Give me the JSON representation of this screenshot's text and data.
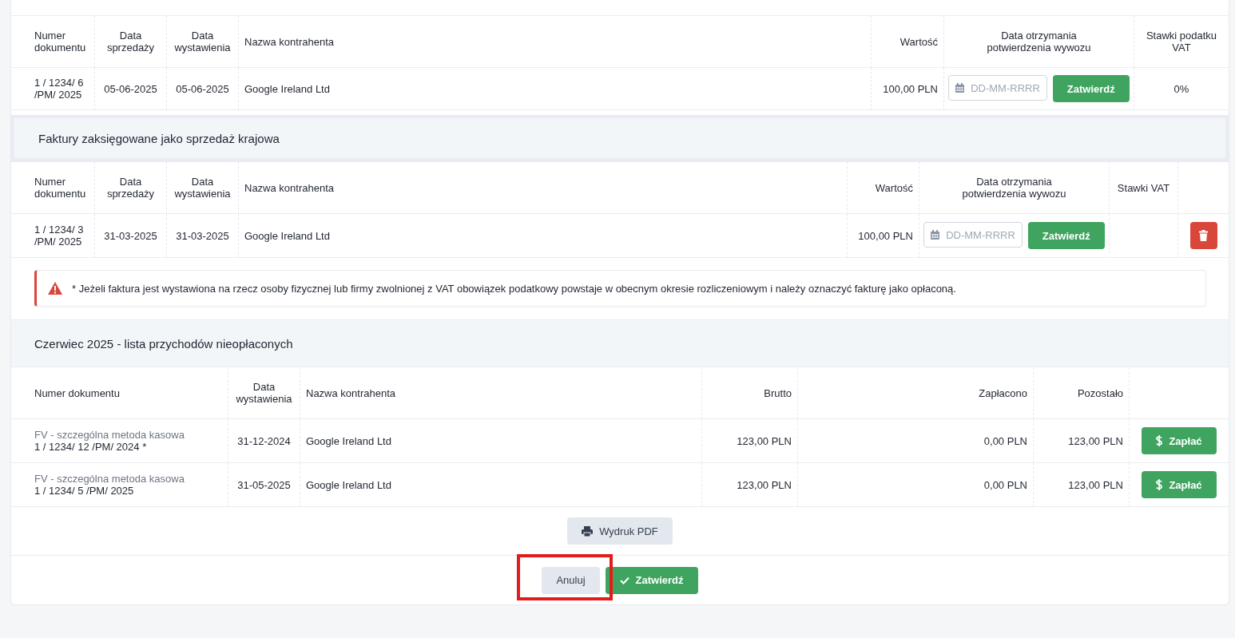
{
  "export_table": {
    "columns": [
      "Numer dokumentu",
      "Data sprzedaży",
      "Data wystawienia",
      "Nazwa kontrahenta",
      "Wartość",
      "Data otrzymania potwierdzenia wywozu",
      "Stawki podatku VAT"
    ],
    "rows": [
      {
        "document_number": "1 / 1234/ 6 /PM/ 2025",
        "sale_date": "05-06-2025",
        "issue_date": "05-06-2025",
        "contractor": "Google Ireland Ltd",
        "value": "100,00 PLN",
        "date_placeholder": "DD-MM-RRRR",
        "confirm_button": "Zatwierdź",
        "vat_rate": "0%"
      }
    ]
  },
  "domestic_section": {
    "title": "Faktury zaksięgowane jako sprzedaż krajowa",
    "columns": [
      "Numer dokumentu",
      "Data sprzedaży",
      "Data wystawienia",
      "Nazwa kontrahenta",
      "Wartość",
      "Data otrzymania potwierdzenia wywozu",
      "Stawki VAT"
    ],
    "rows": [
      {
        "document_number": "1 / 1234/ 3 /PM/ 2025",
        "sale_date": "31-03-2025",
        "issue_date": "31-03-2025",
        "contractor": "Google Ireland Ltd",
        "value": "100,00 PLN",
        "date_placeholder": "DD-MM-RRRR",
        "confirm_button": "Zatwierdź"
      }
    ]
  },
  "alert": {
    "text": "* Jeżeli faktura jest wystawiona na rzecz osoby fizycznej lub firmy zwolnionej z VAT obowiązek podatkowy powstaje w obecnym okresie rozliczeniowym i należy oznaczyć fakturę jako opłaconą."
  },
  "unpaid_section": {
    "title": "Czerwiec 2025 - lista przychodów nieopłaconych",
    "columns": [
      "Numer dokumentu",
      "Data wystawienia",
      "Nazwa kontrahenta",
      "Brutto",
      "Zapłacono",
      "Pozostało"
    ],
    "rows": [
      {
        "document_type": "FV - szczególna metoda kasowa",
        "document_number": "1 / 1234/ 12 /PM/ 2024 *",
        "issue_date": "31-12-2024",
        "contractor": "Google Ireland Ltd",
        "gross": "123,00 PLN",
        "paid": "0,00 PLN",
        "remaining": "123,00 PLN",
        "pay_button": "Zapłać"
      },
      {
        "document_type": "FV - szczególna metoda kasowa",
        "document_number": "1 / 1234/ 5 /PM/ 2025",
        "issue_date": "31-05-2025",
        "contractor": "Google Ireland Ltd",
        "gross": "123,00 PLN",
        "paid": "0,00 PLN",
        "remaining": "123,00 PLN",
        "pay_button": "Zapłać"
      }
    ]
  },
  "print_button": "Wydruk PDF",
  "footer_buttons": [
    {
      "kind": "cancel",
      "label": "Anuluj",
      "highlighted": true
    },
    {
      "kind": "confirm",
      "label": "Zatwierdź"
    }
  ]
}
